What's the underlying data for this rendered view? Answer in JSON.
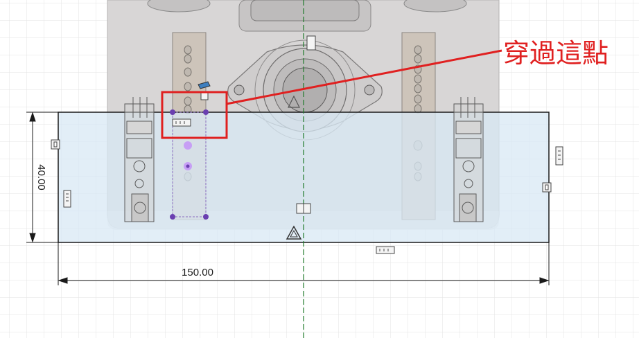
{
  "dimensions": {
    "width_label": "150.00",
    "height_label": "40.00"
  },
  "annotation": {
    "text": "穿過這點",
    "color": "#e02020"
  },
  "colors": {
    "sketch_fill": "#d8e8f4",
    "body_gray": "#d4d2d2",
    "axis_green": "#1f7a2a",
    "point_purple": "#7a4fc0"
  },
  "icons": [
    "constraint-icon",
    "parallel-constraint-icon",
    "midpoint-triangle-icon",
    "origin-axis"
  ]
}
